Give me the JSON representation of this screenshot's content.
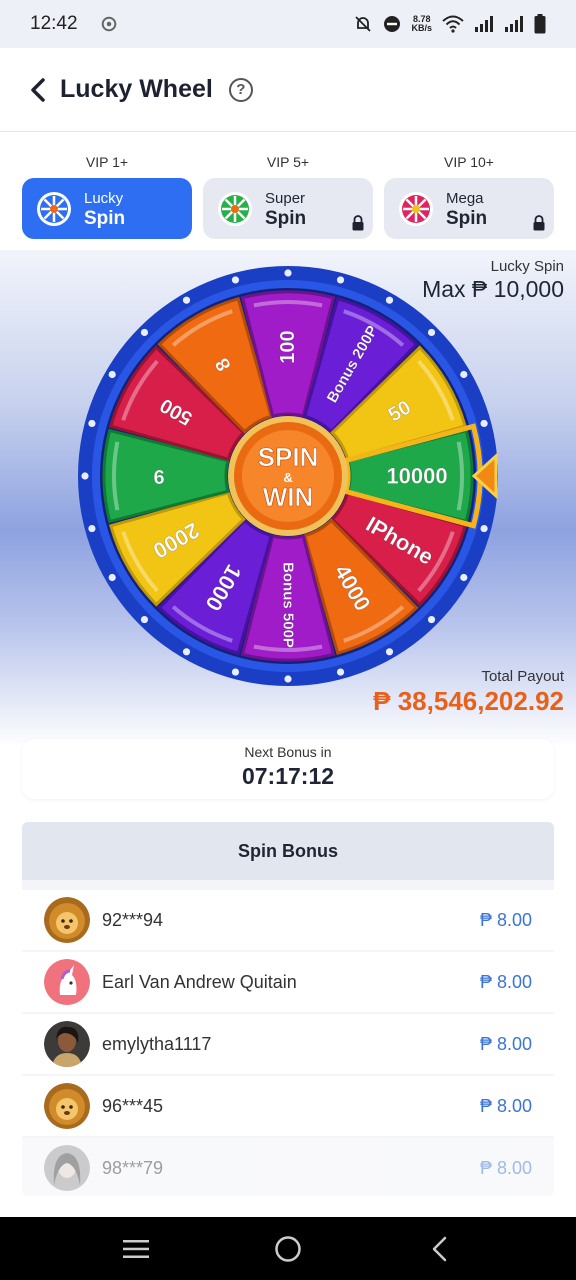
{
  "status_bar": {
    "time": "12:42",
    "net_speed_value": "8.78",
    "net_speed_unit": "KB/s",
    "icons": [
      "bell-off-icon",
      "do-not-disturb-icon",
      "wifi-icon",
      "signal-icon",
      "signal-icon",
      "battery-icon"
    ]
  },
  "header": {
    "title": "Lucky Wheel",
    "back_icon": "chevron-left-icon",
    "help_label": "?"
  },
  "tiers": [
    {
      "requirement": "VIP 1+",
      "name": "Lucky",
      "type": "Spin",
      "active": true,
      "locked": false,
      "icon_color": "#2d6ef2"
    },
    {
      "requirement": "VIP 5+",
      "name": "Super",
      "type": "Spin",
      "active": false,
      "locked": true,
      "icon_color": "#26b04a"
    },
    {
      "requirement": "VIP 10+",
      "name": "Mega",
      "type": "Spin",
      "active": false,
      "locked": true,
      "icon_color": "#e0245e"
    }
  ],
  "wheel": {
    "mode_label": "Lucky Spin",
    "max_win": "Max ₱ 10,000",
    "center_line1": "SPIN",
    "center_amp": "&",
    "center_line2": "WIN",
    "segments": [
      {
        "label": "10000",
        "color": "#1ea84a"
      },
      {
        "label": "IPhone",
        "color": "#d81f4a"
      },
      {
        "label": "4000",
        "color": "#f06a12"
      },
      {
        "label": "Bonus 500P",
        "color": "#a01cc8"
      },
      {
        "label": "1000",
        "color": "#6a1fd6"
      },
      {
        "label": "2000",
        "color": "#f2c514"
      },
      {
        "label": "9",
        "color": "#1ea84a"
      },
      {
        "label": "500",
        "color": "#d81f4a"
      },
      {
        "label": "8",
        "color": "#f06a12"
      },
      {
        "label": "100",
        "color": "#a01cc8"
      },
      {
        "label": "Bonus 200P",
        "color": "#6a1fd6"
      },
      {
        "label": "50",
        "color": "#f2c514"
      }
    ]
  },
  "payout": {
    "label": "Total Payout",
    "value": "₱ 38,546,202.92"
  },
  "next_bonus": {
    "label": "Next Bonus in",
    "timer": "07:17:12"
  },
  "spin_bonus": {
    "title": "Spin Bonus",
    "rows": [
      {
        "name": "92***94",
        "amount": "₱ 8.00",
        "avatar": "lion-avatar"
      },
      {
        "name": "Earl Van Andrew Quitain",
        "amount": "₱ 8.00",
        "avatar": "unicorn-avatar"
      },
      {
        "name": "emylytha1117",
        "amount": "₱ 8.00",
        "avatar": "person-avatar"
      },
      {
        "name": "96***45",
        "amount": "₱ 8.00",
        "avatar": "lion-avatar"
      },
      {
        "name": "98***79",
        "amount": "₱ 8.00",
        "avatar": "person-avatar"
      }
    ]
  },
  "colors": {
    "accent": "#2d6ef2",
    "payout": "#e8611a",
    "amount": "#3c74d6"
  },
  "nav": [
    "menu-icon",
    "home-icon",
    "back-icon"
  ]
}
